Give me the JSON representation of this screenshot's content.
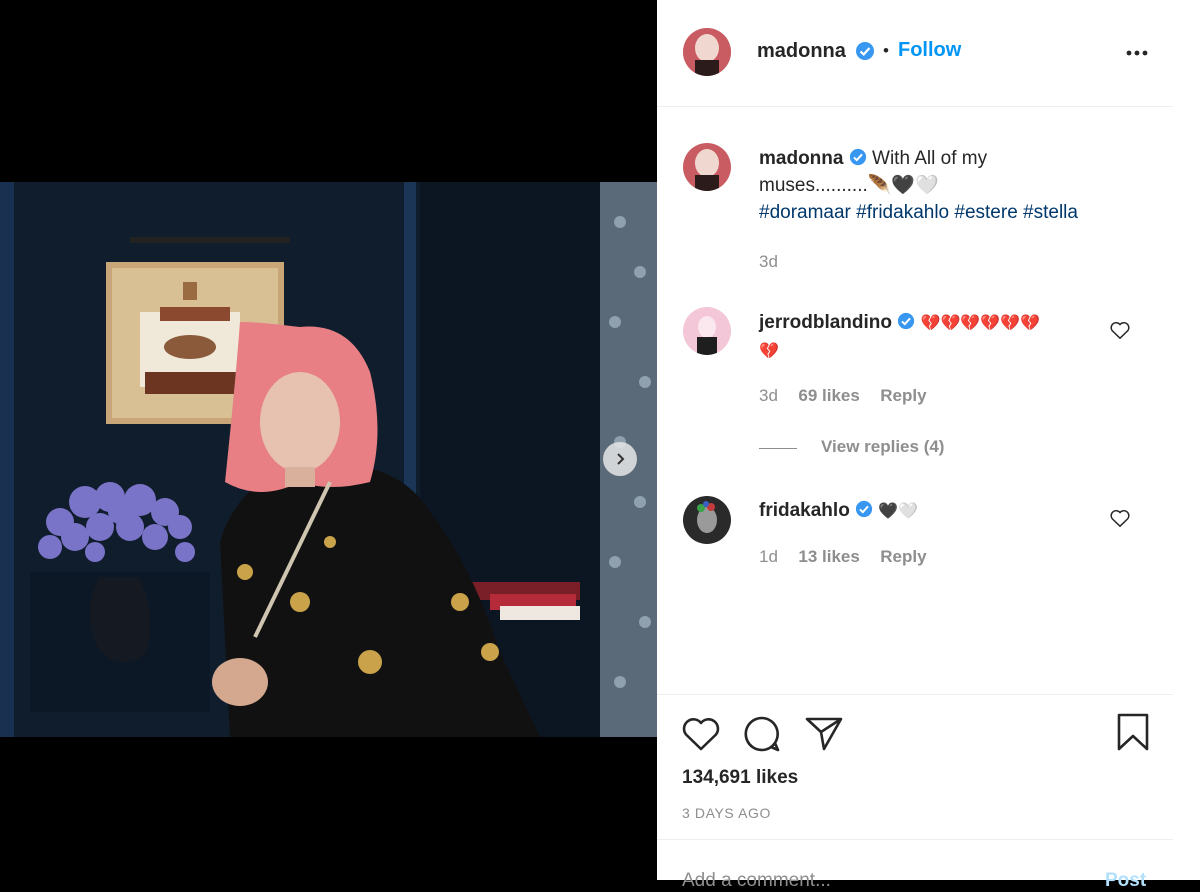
{
  "header": {
    "username": "madonna",
    "separator": "•",
    "follow_label": "Follow",
    "more_icon": "more-options-icon"
  },
  "caption": {
    "username": "madonna",
    "text_line1": "With All of my",
    "text_line2": "muses..........🪶🖤🤍",
    "hashtags": "#doramaar #fridakahlo #estere #stella",
    "age": "3d"
  },
  "comments": [
    {
      "username": "jerrodblandino",
      "text_line1": "💔💔💔💔💔💔",
      "text_line2": "💔",
      "age": "3d",
      "likes": "69 likes",
      "reply_label": "Reply",
      "view_replies": "View replies (4)"
    },
    {
      "username": "fridakahlo",
      "text": "🖤🤍",
      "age": "1d",
      "likes": "13 likes",
      "reply_label": "Reply"
    }
  ],
  "actions": {
    "likes": "134,691 likes",
    "date": "3 DAYS AGO"
  },
  "comment_box": {
    "placeholder": "Add a comment...",
    "post_label": "Post"
  },
  "colors": {
    "link_blue": "#0095f6",
    "verified_blue": "#3897f0",
    "hashtag": "#00376b",
    "text": "#262626",
    "muted": "#8e8e8e"
  }
}
